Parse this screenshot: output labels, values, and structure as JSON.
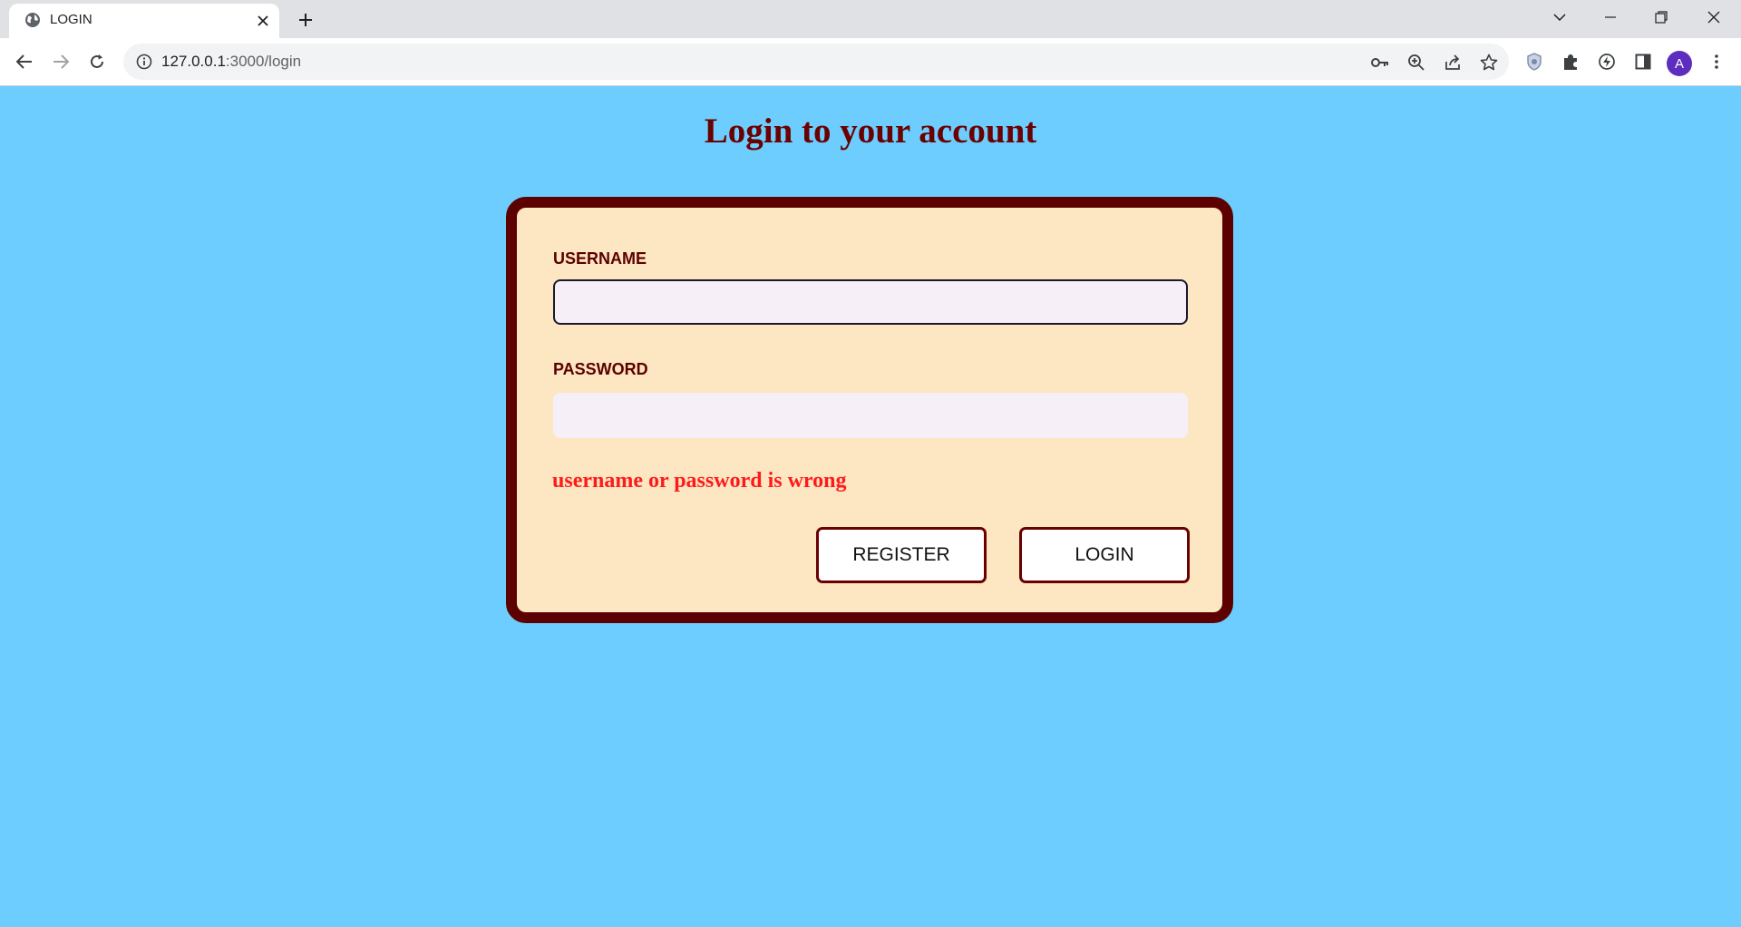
{
  "browser": {
    "tab_title": "LOGIN",
    "url_host": "127.0.0.1",
    "url_path": ":3000/login",
    "profile_initial": "A"
  },
  "page": {
    "title": "Login to your account",
    "username_label": "USERNAME",
    "username_value": "",
    "password_label": "PASSWORD",
    "password_value": "",
    "error_message": "username or password is wrong",
    "register_label": "REGISTER",
    "login_label": "LOGIN"
  },
  "colors": {
    "page_background": "#6dcdff",
    "card_background": "#fde6c2",
    "card_border": "#5c0000",
    "title": "#6b0000",
    "error": "#ff1a1a",
    "profile_avatar": "#5c2dbf"
  }
}
